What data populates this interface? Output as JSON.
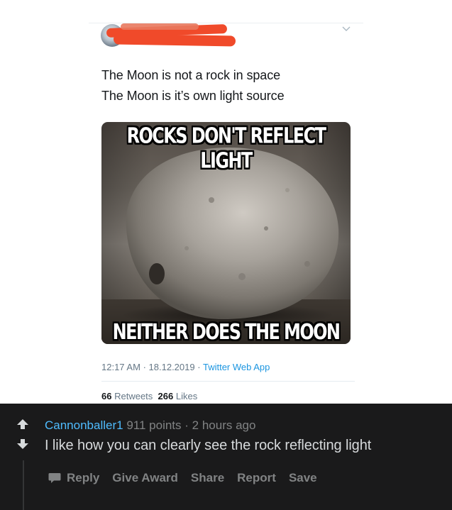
{
  "tweet": {
    "lines": [
      "The Moon is not a rock in space",
      "The Moon is it’s own light source"
    ],
    "image": {
      "caption_top": "ROCKS DON'T REFLECT LIGHT",
      "caption_bottom": "NEITHER DOES THE MOON"
    },
    "time": "12:17 AM",
    "date": "18.12.2019",
    "source": "Twitter Web App",
    "retweets_count": "66",
    "retweets_label": "Retweets",
    "likes_count": "266",
    "likes_label": "Likes",
    "icons": {
      "menu": "chevron-down-icon",
      "avatar": "profile-avatar"
    },
    "colors": {
      "link": "#1b95e0",
      "redaction": "#f04a2a"
    }
  },
  "comment": {
    "username": "Cannonballer1",
    "points": "911 points",
    "separator": "·",
    "age": "2 hours ago",
    "body": "I like how you can clearly see the rock reflecting light",
    "actions": {
      "reply": "Reply",
      "give_award": "Give Award",
      "share": "Share",
      "report": "Report",
      "save": "Save"
    },
    "icons": {
      "upvote": "upvote-arrow-icon",
      "downvote": "downvote-arrow-icon",
      "reply": "speech-bubble-icon"
    },
    "colors": {
      "background": "#1a1a1b",
      "username": "#4fbcff",
      "meta": "#818384",
      "body": "#d7dadc"
    }
  }
}
